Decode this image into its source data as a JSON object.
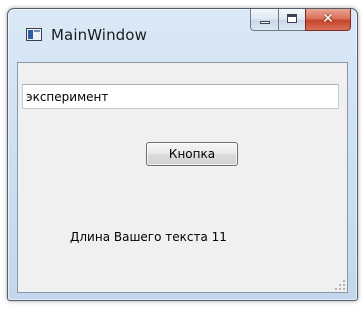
{
  "window": {
    "title": "MainWindow",
    "close_glyph": "✕"
  },
  "icons": {
    "app": "app-window-icon",
    "minimize": "minimize-icon",
    "maximize": "maximize-icon",
    "close": "close-icon",
    "grip": "resize-grip-icon"
  },
  "main": {
    "input_value": "эксперимент",
    "button_label": "Кнопка",
    "result_label": "Длина Вашего текста 11"
  },
  "colors": {
    "frame": "#cfe0f2",
    "client_bg": "#f0f0f0",
    "close_button": "#c7442a"
  }
}
